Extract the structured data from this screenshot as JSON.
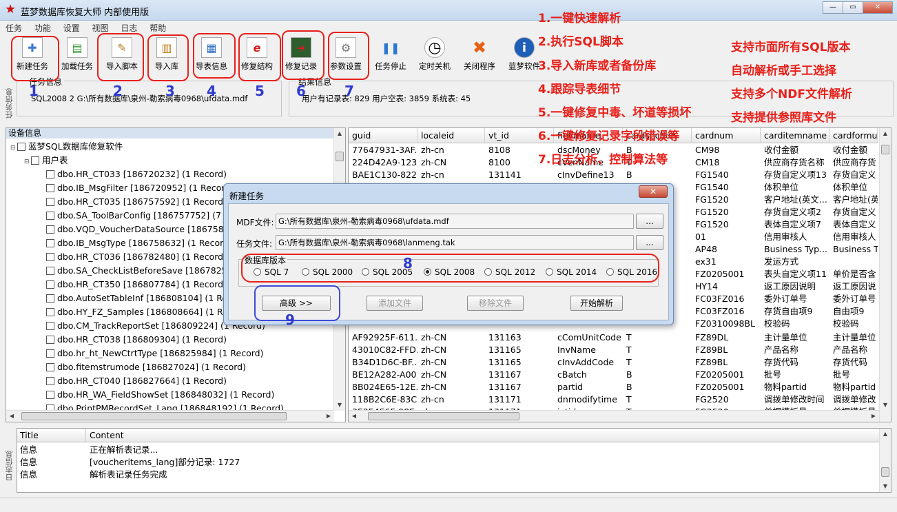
{
  "window": {
    "title": "蓝梦数据库恢复大师 内部使用版",
    "min": "—",
    "max": "▭",
    "close": "✕"
  },
  "menu": [
    "任务",
    "功能",
    "设置",
    "视图",
    "日志",
    "帮助"
  ],
  "toolbar": [
    {
      "label": "新建任务",
      "icon": "new-task-icon",
      "glyph": "✚"
    },
    {
      "label": "加载任务",
      "icon": "load-task-icon",
      "glyph": "▤"
    },
    {
      "label": "导入脚本",
      "icon": "import-script-icon",
      "glyph": "✎"
    },
    {
      "label": "导入库",
      "icon": "import-db-icon",
      "glyph": "▥"
    },
    {
      "label": "导表信息",
      "icon": "export-table-icon",
      "glyph": "▦"
    },
    {
      "label": "修复结构",
      "icon": "repair-structure-icon",
      "glyph": "e"
    },
    {
      "label": "修复记录",
      "icon": "repair-records-icon",
      "glyph": "➜"
    },
    {
      "label": "参数设置",
      "icon": "settings-icon",
      "glyph": "⚙"
    },
    {
      "label": "任务停止",
      "icon": "pause-icon",
      "glyph": "❚❚"
    },
    {
      "label": "定时关机",
      "icon": "clock-icon",
      "glyph": "◷"
    },
    {
      "label": "关闭程序",
      "icon": "close-program-icon",
      "glyph": "✖"
    },
    {
      "label": "蓝梦软件",
      "icon": "info-icon",
      "glyph": "i"
    }
  ],
  "task_info": {
    "title": "任务信息",
    "text": "SQL2008 2 G:\\所有数据库\\泉州-勒索病毒0968\\ufdata.mdf",
    "side": "任务信息"
  },
  "result_info": {
    "title": "结果信息",
    "text": "用户有记录表: 829  用户空表: 3859  系统表: 45"
  },
  "tree": {
    "header": "设备信息",
    "root": "蓝梦SQL数据库修复软件",
    "group": "用户表",
    "items": [
      "dbo.HR_CT033 [186720232] (1 Record)",
      "dbo.IB_MsgFilter [186720952] (1 Record)",
      "dbo.HR_CT035 [186757592] (1 Record)",
      "dbo.SA_ToolBarConfig [186757752] (7 Re",
      "dbo.VQD_VoucherDataSource [18675807",
      "dbo.IB_MsgType [186758632] (1 Record)",
      "dbo.HR_CT036 [186782480] (1 Record)",
      "dbo.SA_CheckListBeforeSave [18678256",
      "dbo.HR_CT350 [186807784] (1 Record)",
      "dbo.AutoSetTableInf [186808104] (1 Reco",
      "dbo.HY_FZ_Samples [186808664] (1 Reco",
      "dbo.CM_TrackReportSet [186809224] (1 Record)",
      "dbo.HR_CT038 [186809304] (1 Record)",
      "dbo.hr_ht_NewCtrtType [186825984] (1 Record)",
      "dbo.fitemstrumode [186827024] (1 Record)",
      "dbo.HR_CT040 [186827664] (1 Record)",
      "dbo.HR_WA_FieldShowSet [186848032] (1 Record)",
      "dbo.PrintPMRecordSet_Lang [186848192] (1 Record)"
    ]
  },
  "grid": {
    "columns": [
      "guid",
      "localeid",
      "vt_id",
      "fieldname",
      "cardsection",
      "cardnum",
      "carditemname",
      "cardformula"
    ],
    "top_rows": [
      [
        "77647931-3AF...",
        "zh-cn",
        "8108",
        "dscMoney",
        "B",
        "CM98",
        "收付金额",
        "收付金额"
      ],
      [
        "224D42A9-123...",
        "zh-CN",
        "8100",
        "cVenName",
        "T",
        "CM18",
        "供应商存货名称",
        "供应商存货"
      ],
      [
        "BAE1C130-822...",
        "zh-cn",
        "131141",
        "cInvDefine13",
        "B",
        "FG1540",
        "存货自定义项13",
        "存货自定义"
      ]
    ],
    "right_rows": [
      [
        "FG1540",
        "体积单位",
        "体积单位"
      ],
      [
        "FG1520",
        "客户地址(英文...",
        "客户地址(英"
      ],
      [
        "FG1520",
        "存货自定义项2",
        "存货自定义"
      ],
      [
        "FG1520",
        "表体自定义项7",
        "表体自定义"
      ],
      [
        "01",
        "信用审核人",
        "信用审核人"
      ],
      [
        "AP48",
        "Business Typ...",
        "Business T"
      ],
      [
        "ex31",
        "发运方式",
        ""
      ],
      [
        "FZ0205001",
        "表头自定义项11",
        "单价是否含"
      ],
      [
        "HY14",
        "返工原因说明",
        "返工原因说"
      ],
      [
        "FC03FZ016",
        "委外订单号",
        "委外订单号"
      ],
      [
        "FC03FZ016",
        "存货自由项9",
        "自由项9"
      ],
      [
        "FZ0310098BL",
        "校验码",
        "校验码"
      ]
    ],
    "bottom_rows": [
      [
        "AF92925F-611...",
        "zh-CN",
        "131163",
        "cComUnitCode",
        "T",
        "FZ89DL",
        "主计量单位",
        "主计量单位"
      ],
      [
        "43010C82-FFD...",
        "zh-CN",
        "131165",
        "InvName",
        "T",
        "FZ89BL",
        "产品名称",
        "产品名称"
      ],
      [
        "B34D1D6C-BF...",
        "zh-CN",
        "131165",
        "cInvAddCode",
        "T",
        "FZ89BL",
        "存货代码",
        "存货代码"
      ],
      [
        "BE12A282-A00...",
        "zh-CN",
        "131167",
        "cBatch",
        "B",
        "FZ0205001",
        "批号",
        "批号"
      ],
      [
        "8B024E65-12E...",
        "zh-CN",
        "131167",
        "partid",
        "B",
        "FZ0205001",
        "物料partid",
        "物料partid"
      ],
      [
        "118B2C6E-83C...",
        "zh-cn",
        "131171",
        "dnmodifytime",
        "T",
        "FG2520",
        "调拨单修改时间",
        "调拨单修改"
      ],
      [
        "3E2E4E6F-98E...",
        "zh-cn",
        "131171",
        "ivtid",
        "T",
        "FG2520",
        "单据模板号",
        "单据模板号"
      ]
    ]
  },
  "log": {
    "side": "日志信息",
    "columns": [
      "Title",
      "Content"
    ],
    "rows": [
      [
        "信息",
        "正在解析表记录..."
      ],
      [
        "信息",
        "[voucheritems_lang]部分记录: 1727"
      ],
      [
        "信息",
        "解析表记录任务完成"
      ]
    ]
  },
  "dialog": {
    "title": "新建任务",
    "close": "✕",
    "mdf_label": "MDF文件:",
    "mdf_value": "G:\\所有数据库\\泉州-勒索病毒0968\\ufdata.mdf",
    "task_label": "任务文件:",
    "task_value": "G:\\所有数据库\\泉州-勒索病毒0968\\lanmeng.tak",
    "browse": "...",
    "version_group": "数据库版本",
    "versions": [
      "SQL 7",
      "SQL 2000",
      "SQL 2005",
      "SQL 2008",
      "SQL 2012",
      "SQL 2014",
      "SQL 2016"
    ],
    "selected": "SQL 2008",
    "advanced": "高级 >>",
    "add_file": "添加文件",
    "remove_file": "移除文件",
    "start": "开始解析"
  },
  "annotations": {
    "features": [
      "1.一键快速解析",
      "2.执行SQL脚本",
      "3.导入新库或者备份库",
      "4.跟踪导表细节",
      "5.一键修复中毒、坏道等损坏",
      "6.一键修复记录字段错误等",
      "7.日志分析、控制算法等"
    ],
    "claims": [
      "支持市面所有SQL版本",
      "自动解析或手工选择",
      "支持多个NDF文件解析",
      "支持提供参照库文件"
    ],
    "numbers": [
      "1",
      "2",
      "3",
      "4",
      "5",
      "6",
      "7",
      "8",
      "9"
    ]
  }
}
